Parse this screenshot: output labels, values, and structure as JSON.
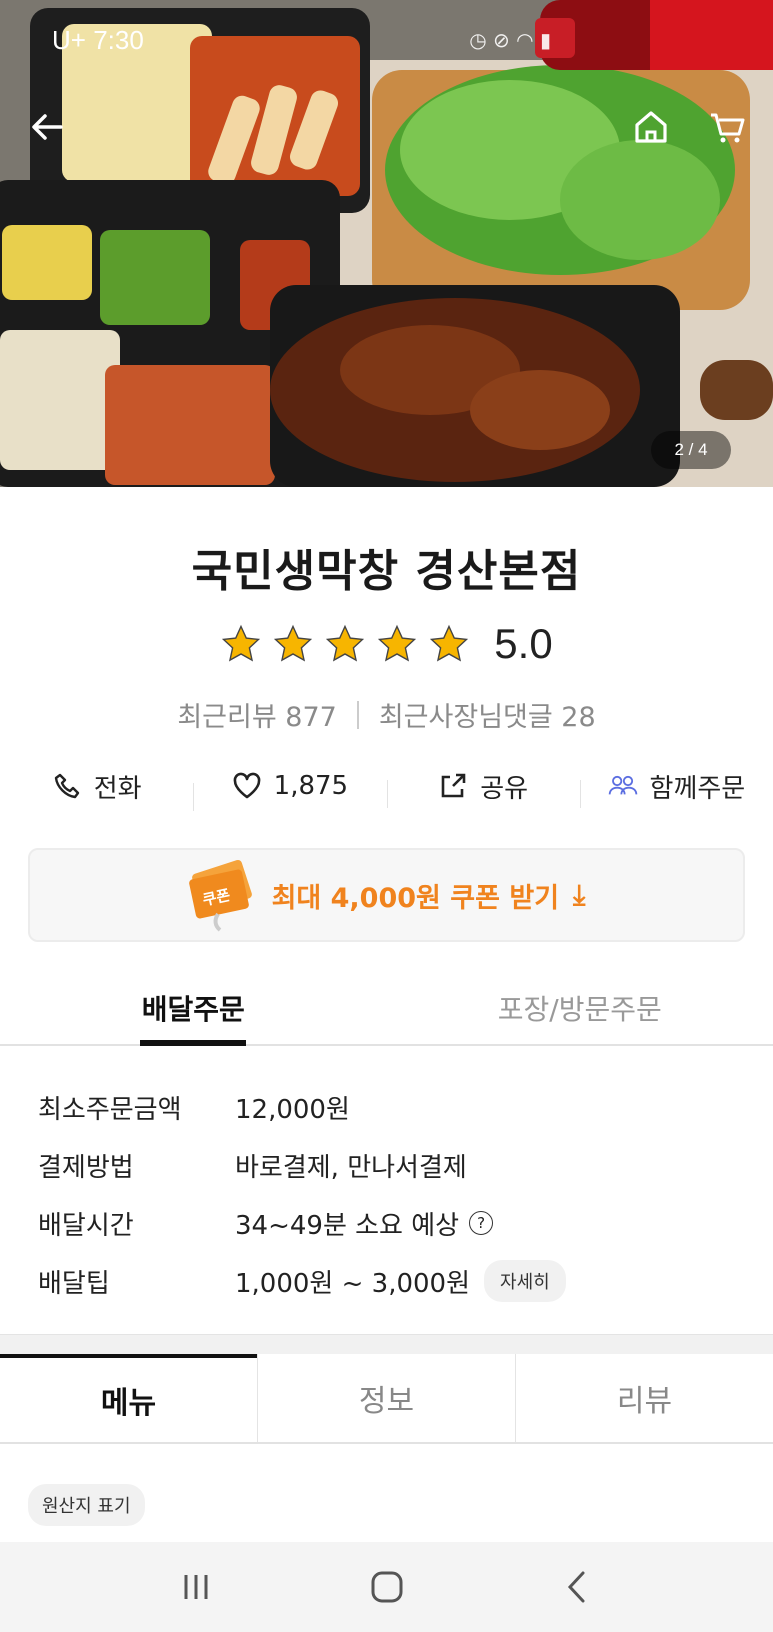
{
  "status_bar": {
    "time": "7:30",
    "carrier": "U+"
  },
  "hero": {
    "page_counter": "2 / 4"
  },
  "store": {
    "name": "국민생막창 경산본점",
    "rating": "5.0",
    "stars_filled": 5,
    "recent_reviews_label": "최근리뷰 877",
    "owner_replies_label": "최근사장님댓글 28"
  },
  "actions": {
    "call": "전화",
    "likes": "1,875",
    "share": "공유",
    "group_order": "함께주문"
  },
  "coupon": {
    "label": "최대 4,000원 쿠폰 받기",
    "badge": "쿠폰"
  },
  "order_tabs": {
    "delivery": "배달주문",
    "pickup": "포장/방문주문"
  },
  "info": {
    "rows": [
      {
        "label": "최소주문금액",
        "value": "12,000원"
      },
      {
        "label": "결제방법",
        "value": "바로결제, 만나서결제"
      },
      {
        "label": "배달시간",
        "value": "34~49분 소요 예상"
      },
      {
        "label": "배달팁",
        "value": "1,000원 ~ 3,000원"
      }
    ],
    "detail_button": "자세히"
  },
  "menu_tabs": {
    "menu": "메뉴",
    "info": "정보",
    "review": "리뷰"
  },
  "origin_chip": "원산지 표기",
  "colors": {
    "accent": "#f0831e",
    "star": "#f7b500",
    "group_icon": "#5b6ee1"
  }
}
